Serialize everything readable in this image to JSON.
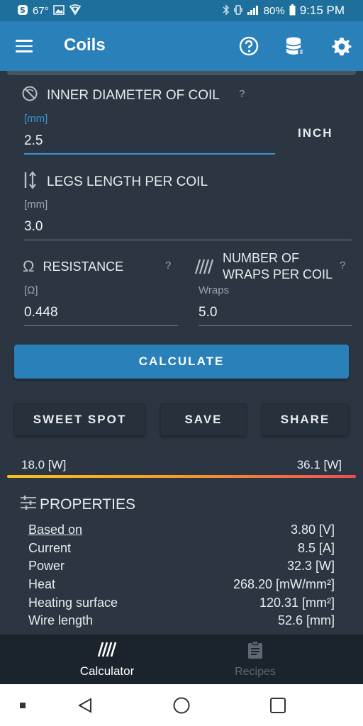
{
  "status_bar": {
    "temperature": "67°",
    "battery": "80%",
    "time": "9:15 PM"
  },
  "app_bar": {
    "title": "Coils",
    "icons": [
      "menu-icon",
      "help-circle-icon",
      "database-icon",
      "gear-icon"
    ]
  },
  "inner_diameter": {
    "label": "INNER DIAMETER OF COIL",
    "help": "?",
    "unit": "[mm]",
    "value": "2.5",
    "toggle_label": "INCH"
  },
  "legs_length": {
    "label": "LEGS LENGTH PER COIL",
    "unit": "[mm]",
    "value": "3.0"
  },
  "resistance": {
    "symbol": "Ω",
    "label": "RESISTANCE",
    "help": "?",
    "unit": "[Ω]",
    "value": "0.448"
  },
  "wraps": {
    "label_line1": "NUMBER OF",
    "label_line2": "WRAPS PER COIL",
    "help": "?",
    "unit": "Wraps",
    "value": "5.0"
  },
  "buttons": {
    "calculate": "CALCULATE",
    "sweet_spot": "SWEET SPOT",
    "save": "SAVE",
    "share": "SHARE"
  },
  "power_range": {
    "min": "18.0 [W]",
    "max": "36.1 [W]"
  },
  "properties": {
    "title": "PROPERTIES",
    "rows": [
      {
        "key": "Based on",
        "value": "3.80 [V]"
      },
      {
        "key": "Current",
        "value": "8.5 [A]"
      },
      {
        "key": "Power",
        "value": "32.3 [W]"
      },
      {
        "key": "Heat",
        "value": "268.20 [mW/mm²]"
      },
      {
        "key": "Heating surface",
        "value": "120.31 [mm²]"
      },
      {
        "key": "Wire length",
        "value": "52.6 [mm]"
      }
    ]
  },
  "bottom_nav": {
    "calculator": "Calculator",
    "recipes": "Recipes"
  },
  "colors": {
    "app_bar": "#2a80b9",
    "status_bar": "#1f6f9c",
    "background": "#2b3642",
    "accent": "#3a94d4"
  }
}
